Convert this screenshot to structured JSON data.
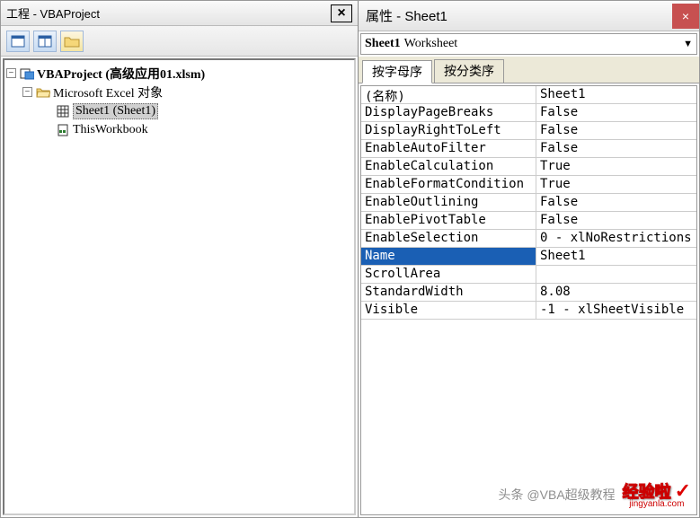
{
  "project_pane": {
    "title": "工程 - VBAProject",
    "close_label": "×",
    "tree": {
      "root_label": "VBAProject (高级应用01.xlsm)",
      "folder_label": "Microsoft Excel 对象",
      "items": [
        {
          "label": "Sheet1 (Sheet1)",
          "selected": true
        },
        {
          "label": "ThisWorkbook",
          "selected": false
        }
      ]
    }
  },
  "properties_pane": {
    "title": "属性 - Sheet1",
    "close_label": "×",
    "object_combo": {
      "name": "Sheet1",
      "type": "Worksheet"
    },
    "tabs": [
      {
        "label": "按字母序",
        "active": true
      },
      {
        "label": "按分类序",
        "active": false
      }
    ],
    "rows": [
      {
        "name": "(名称)",
        "value": "Sheet1",
        "selected": false
      },
      {
        "name": "DisplayPageBreaks",
        "value": "False",
        "selected": false
      },
      {
        "name": "DisplayRightToLeft",
        "value": "False",
        "selected": false
      },
      {
        "name": "EnableAutoFilter",
        "value": "False",
        "selected": false
      },
      {
        "name": "EnableCalculation",
        "value": "True",
        "selected": false
      },
      {
        "name": "EnableFormatCondition",
        "value": "True",
        "selected": false
      },
      {
        "name": "EnableOutlining",
        "value": "False",
        "selected": false
      },
      {
        "name": "EnablePivotTable",
        "value": "False",
        "selected": false
      },
      {
        "name": "EnableSelection",
        "value": "0 - xlNoRestrictions",
        "selected": false
      },
      {
        "name": "Name",
        "value": "Sheet1",
        "selected": true
      },
      {
        "name": "ScrollArea",
        "value": "",
        "selected": false
      },
      {
        "name": "StandardWidth",
        "value": "8.08",
        "selected": false
      },
      {
        "name": "Visible",
        "value": "-1 - xlSheetVisible",
        "selected": false
      }
    ]
  },
  "watermark": {
    "author": "头条 @VBA超级教程",
    "site": "经验啦",
    "domain": "jingyanla.com"
  }
}
